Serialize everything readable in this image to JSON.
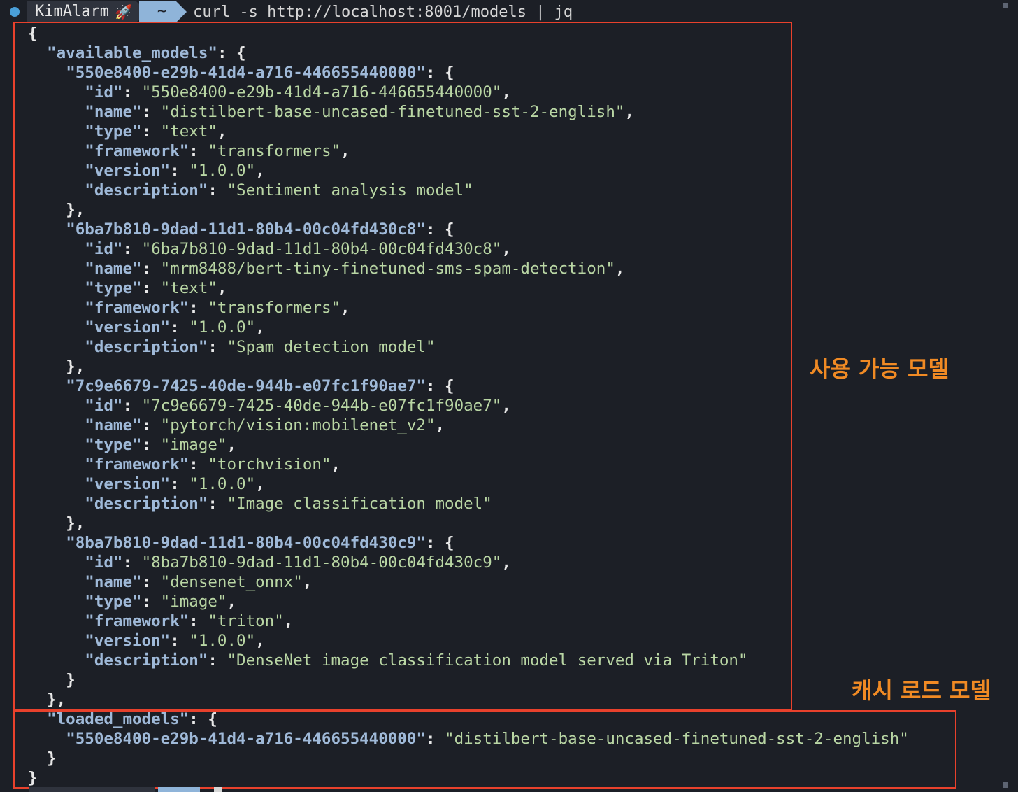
{
  "prompt": {
    "user": "KimAlarm",
    "user_icon": "🚀",
    "dir": "~",
    "command": "curl -s http://localhost:8001/models | jq"
  },
  "available_models": [
    {
      "key": "550e8400-e29b-41d4-a716-446655440000",
      "id": "550e8400-e29b-41d4-a716-446655440000",
      "name": "distilbert-base-uncased-finetuned-sst-2-english",
      "type": "text",
      "framework": "transformers",
      "version": "1.0.0",
      "description": "Sentiment analysis model"
    },
    {
      "key": "6ba7b810-9dad-11d1-80b4-00c04fd430c8",
      "id": "6ba7b810-9dad-11d1-80b4-00c04fd430c8",
      "name": "mrm8488/bert-tiny-finetuned-sms-spam-detection",
      "type": "text",
      "framework": "transformers",
      "version": "1.0.0",
      "description": "Spam detection model"
    },
    {
      "key": "7c9e6679-7425-40de-944b-e07fc1f90ae7",
      "id": "7c9e6679-7425-40de-944b-e07fc1f90ae7",
      "name": "pytorch/vision:mobilenet_v2",
      "type": "image",
      "framework": "torchvision",
      "version": "1.0.0",
      "description": "Image classification model"
    },
    {
      "key": "8ba7b810-9dad-11d1-80b4-00c04fd430c9",
      "id": "8ba7b810-9dad-11d1-80b4-00c04fd430c9",
      "name": "densenet_onnx",
      "type": "image",
      "framework": "triton",
      "version": "1.0.0",
      "description": "DenseNet image classification model served via Triton"
    }
  ],
  "loaded_models": [
    {
      "key": "550e8400-e29b-41d4-a716-446655440000",
      "value": "distilbert-base-uncased-finetuned-sst-2-english"
    }
  ],
  "annotations": {
    "available": "사용 가능 모델",
    "loaded": "캐시 로드 모델"
  },
  "colors": {
    "background": "#1c1f26",
    "json_key": "#9fb9d8",
    "json_string": "#b9d6a4",
    "annotation_box": "#e8412c",
    "annotation_text": "#f08a24"
  }
}
